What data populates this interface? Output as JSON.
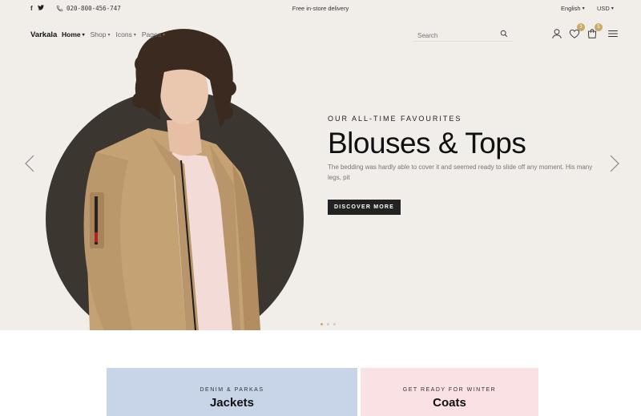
{
  "topbar": {
    "social_icons": [
      "facebook-icon",
      "twitter-icon"
    ],
    "phone": "020-800-456-747",
    "promo": "Free in-store delivery",
    "language": "English",
    "currency": "USD"
  },
  "nav": {
    "logo": "Varkala",
    "menu": [
      {
        "label": "Home",
        "active": true
      },
      {
        "label": "Shop",
        "active": false
      },
      {
        "label": "Icons",
        "active": false
      },
      {
        "label": "Pages",
        "active": false
      }
    ],
    "search_placeholder": "Search",
    "wishlist_count": "3",
    "cart_count": "5"
  },
  "hero": {
    "subtitle": "OUR ALL-TIME FAVOURITES",
    "title": "Blouses & Tops",
    "description": "The bedding was hardly able to cover it and seemed ready to slide off any moment. His many legs, pit",
    "cta": "DISCOVER MORE",
    "active_slide": 1,
    "slide_count": 3,
    "circle_color": "#3c3630",
    "background_color": "#f1eeea"
  },
  "categories": [
    {
      "kicker": "DENIM & PARKAS",
      "title": "Jackets",
      "bg": "#c8d5e9"
    },
    {
      "kicker": "GET READY FOR WINTER",
      "title": "Coats",
      "bg": "#f9e1e4"
    }
  ],
  "colors": {
    "accent": "#c8a96a",
    "dark": "#222222"
  }
}
